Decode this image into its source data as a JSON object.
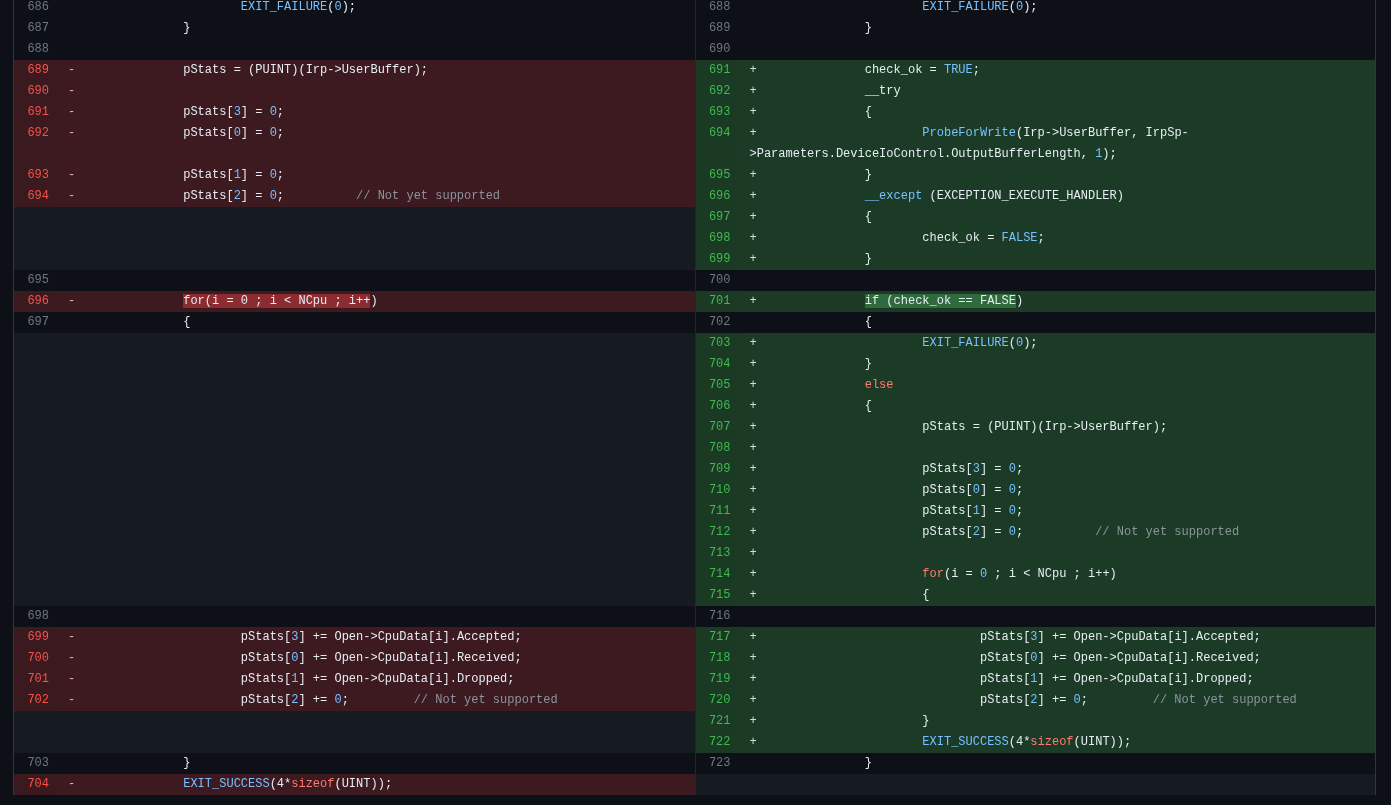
{
  "diff": {
    "rows": [
      {
        "left": {
          "kind": "context",
          "number": "686",
          "code": [
            {
              "text": "\t\t\tEXIT_FAILURE",
              "kind": "fn"
            },
            {
              "text": "(",
              "kind": "plain"
            },
            {
              "text": "0",
              "kind": "num"
            },
            {
              "text": ");",
              "kind": "plain"
            }
          ]
        },
        "right": {
          "kind": "context",
          "number": "688",
          "code": [
            {
              "text": "\t\t\tEXIT_FAILURE",
              "kind": "fn"
            },
            {
              "text": "(",
              "kind": "plain"
            },
            {
              "text": "0",
              "kind": "num"
            },
            {
              "text": ");",
              "kind": "plain"
            }
          ]
        }
      },
      {
        "left": {
          "kind": "context",
          "number": "687",
          "code": [
            {
              "text": "\t\t}",
              "kind": "plain"
            }
          ]
        },
        "right": {
          "kind": "context",
          "number": "689",
          "code": [
            {
              "text": "\t\t}",
              "kind": "plain"
            }
          ]
        }
      },
      {
        "left": {
          "kind": "context",
          "number": "688"
        },
        "right": {
          "kind": "context",
          "number": "690"
        }
      },
      {
        "left": {
          "kind": "deleted",
          "number": "689",
          "marker": "-",
          "code": [
            {
              "text": "\t\tpStats = (PUINT)(Irp->UserBuffer);",
              "kind": "plain"
            }
          ]
        },
        "right": {
          "kind": "added",
          "number": "691",
          "marker": "+",
          "code": [
            {
              "text": "\t\tcheck_ok = ",
              "kind": "plain"
            },
            {
              "text": "TRUE",
              "kind": "const"
            },
            {
              "text": ";",
              "kind": "plain"
            }
          ]
        }
      },
      {
        "left": {
          "kind": "deleted",
          "number": "690",
          "marker": "-"
        },
        "right": {
          "kind": "added",
          "number": "692",
          "marker": "+",
          "code": [
            {
              "text": "\t\t__try",
              "kind": "plain"
            }
          ]
        }
      },
      {
        "left": {
          "kind": "deleted",
          "number": "691",
          "marker": "-",
          "code": [
            {
              "text": "\t\tpStats[",
              "kind": "plain"
            },
            {
              "text": "3",
              "kind": "num"
            },
            {
              "text": "] = ",
              "kind": "plain"
            },
            {
              "text": "0",
              "kind": "num"
            },
            {
              "text": ";",
              "kind": "plain"
            }
          ]
        },
        "right": {
          "kind": "added",
          "number": "693",
          "marker": "+",
          "code": [
            {
              "text": "\t\t{",
              "kind": "plain"
            }
          ]
        }
      },
      {
        "left": {
          "kind": "deleted",
          "number": "692",
          "marker": "-",
          "code": [
            {
              "text": "\t\tpStats[",
              "kind": "plain"
            },
            {
              "text": "0",
              "kind": "num"
            },
            {
              "text": "] = ",
              "kind": "plain"
            },
            {
              "text": "0",
              "kind": "num"
            },
            {
              "text": ";",
              "kind": "plain"
            }
          ]
        },
        "right": {
          "kind": "added",
          "number": "694",
          "marker": "+",
          "code": [
            {
              "text": "\t\t\tProbeForWrite",
              "kind": "fn"
            },
            {
              "text": "(Irp->UserBuffer, IrpSp->Parameters.DeviceIoControl.OutputBufferLength, ",
              "kind": "plain"
            },
            {
              "text": "1",
              "kind": "num"
            },
            {
              "text": ");",
              "kind": "plain"
            }
          ]
        }
      },
      {
        "left": {
          "kind": "deleted",
          "number": "693",
          "marker": "-",
          "code": [
            {
              "text": "\t\tpStats[",
              "kind": "plain"
            },
            {
              "text": "1",
              "kind": "num"
            },
            {
              "text": "] = ",
              "kind": "plain"
            },
            {
              "text": "0",
              "kind": "num"
            },
            {
              "text": ";",
              "kind": "plain"
            }
          ]
        },
        "right": {
          "kind": "added",
          "number": "695",
          "marker": "+",
          "code": [
            {
              "text": "\t\t}",
              "kind": "plain"
            }
          ]
        }
      },
      {
        "left": {
          "kind": "deleted",
          "number": "694",
          "marker": "-",
          "code": [
            {
              "text": "\t\tpStats[",
              "kind": "plain"
            },
            {
              "text": "2",
              "kind": "num"
            },
            {
              "text": "] = ",
              "kind": "plain"
            },
            {
              "text": "0",
              "kind": "num"
            },
            {
              "text": ";\t\t",
              "kind": "plain"
            },
            {
              "text": "// Not yet supported",
              "kind": "comment"
            }
          ]
        },
        "right": {
          "kind": "added",
          "number": "696",
          "marker": "+",
          "code": [
            {
              "text": "\t\t__except",
              "kind": "fn"
            },
            {
              "text": " (EXCEPTION_EXECUTE_HANDLER)",
              "kind": "plain"
            }
          ]
        }
      },
      {
        "left": {
          "kind": "empty"
        },
        "right": {
          "kind": "added",
          "number": "697",
          "marker": "+",
          "code": [
            {
              "text": "\t\t{",
              "kind": "plain"
            }
          ]
        }
      },
      {
        "left": {
          "kind": "empty"
        },
        "right": {
          "kind": "added",
          "number": "698",
          "marker": "+",
          "code": [
            {
              "text": "\t\t\tcheck_ok = ",
              "kind": "plain"
            },
            {
              "text": "FALSE",
              "kind": "const"
            },
            {
              "text": ";",
              "kind": "plain"
            }
          ]
        }
      },
      {
        "left": {
          "kind": "empty"
        },
        "right": {
          "kind": "added",
          "number": "699",
          "marker": "+",
          "code": [
            {
              "text": "\t\t}",
              "kind": "plain"
            }
          ]
        }
      },
      {
        "left": {
          "kind": "context",
          "number": "695"
        },
        "right": {
          "kind": "context",
          "number": "700"
        }
      },
      {
        "left": {
          "kind": "deleted",
          "number": "696",
          "marker": "-",
          "code": [
            {
              "text": "\t\tfor(i = 0 ; i < NCpu ; i++",
              "kind": "plain",
              "highlight": true
            },
            {
              "text": ")",
              "kind": "plain"
            }
          ]
        },
        "right": {
          "kind": "added",
          "number": "701",
          "marker": "+",
          "code": [
            {
              "text": "\t\tif (check_ok == FALSE",
              "kind": "plain",
              "highlight": true
            },
            {
              "text": ")",
              "kind": "plain"
            }
          ]
        }
      },
      {
        "left": {
          "kind": "context",
          "number": "697",
          "code": [
            {
              "text": "\t\t{",
              "kind": "plain"
            }
          ]
        },
        "right": {
          "kind": "context",
          "number": "702",
          "code": [
            {
              "text": "\t\t{",
              "kind": "plain"
            }
          ]
        }
      },
      {
        "left": {
          "kind": "empty"
        },
        "right": {
          "kind": "added",
          "number": "703",
          "marker": "+",
          "code": [
            {
              "text": "\t\t\tEXIT_FAILURE",
              "kind": "fn"
            },
            {
              "text": "(",
              "kind": "plain"
            },
            {
              "text": "0",
              "kind": "num"
            },
            {
              "text": ");",
              "kind": "plain"
            }
          ]
        }
      },
      {
        "left": {
          "kind": "empty"
        },
        "right": {
          "kind": "added",
          "number": "704",
          "marker": "+",
          "code": [
            {
              "text": "\t\t}",
              "kind": "plain"
            }
          ]
        }
      },
      {
        "left": {
          "kind": "empty"
        },
        "right": {
          "kind": "added",
          "number": "705",
          "marker": "+",
          "code": [
            {
              "text": "\t\telse",
              "kind": "kw"
            }
          ]
        }
      },
      {
        "left": {
          "kind": "empty"
        },
        "right": {
          "kind": "added",
          "number": "706",
          "marker": "+",
          "code": [
            {
              "text": "\t\t{",
              "kind": "plain"
            }
          ]
        }
      },
      {
        "left": {
          "kind": "empty"
        },
        "right": {
          "kind": "added",
          "number": "707",
          "marker": "+",
          "code": [
            {
              "text": "\t\t\tpStats = (PUINT)(Irp->UserBuffer);",
              "kind": "plain"
            }
          ]
        }
      },
      {
        "left": {
          "kind": "empty"
        },
        "right": {
          "kind": "added",
          "number": "708",
          "marker": "+"
        }
      },
      {
        "left": {
          "kind": "empty"
        },
        "right": {
          "kind": "added",
          "number": "709",
          "marker": "+",
          "code": [
            {
              "text": "\t\t\tpStats[",
              "kind": "plain"
            },
            {
              "text": "3",
              "kind": "num"
            },
            {
              "text": "] = ",
              "kind": "plain"
            },
            {
              "text": "0",
              "kind": "num"
            },
            {
              "text": ";",
              "kind": "plain"
            }
          ]
        }
      },
      {
        "left": {
          "kind": "empty"
        },
        "right": {
          "kind": "added",
          "number": "710",
          "marker": "+",
          "code": [
            {
              "text": "\t\t\tpStats[",
              "kind": "plain"
            },
            {
              "text": "0",
              "kind": "num"
            },
            {
              "text": "] = ",
              "kind": "plain"
            },
            {
              "text": "0",
              "kind": "num"
            },
            {
              "text": ";",
              "kind": "plain"
            }
          ]
        }
      },
      {
        "left": {
          "kind": "empty"
        },
        "right": {
          "kind": "added",
          "number": "711",
          "marker": "+",
          "code": [
            {
              "text": "\t\t\tpStats[",
              "kind": "plain"
            },
            {
              "text": "1",
              "kind": "num"
            },
            {
              "text": "] = ",
              "kind": "plain"
            },
            {
              "text": "0",
              "kind": "num"
            },
            {
              "text": ";",
              "kind": "plain"
            }
          ]
        }
      },
      {
        "left": {
          "kind": "empty"
        },
        "right": {
          "kind": "added",
          "number": "712",
          "marker": "+",
          "code": [
            {
              "text": "\t\t\tpStats[",
              "kind": "plain"
            },
            {
              "text": "2",
              "kind": "num"
            },
            {
              "text": "] = ",
              "kind": "plain"
            },
            {
              "text": "0",
              "kind": "num"
            },
            {
              "text": ";\t\t",
              "kind": "plain"
            },
            {
              "text": "// Not yet supported",
              "kind": "comment"
            }
          ]
        }
      },
      {
        "left": {
          "kind": "empty"
        },
        "right": {
          "kind": "added",
          "number": "713",
          "marker": "+"
        }
      },
      {
        "left": {
          "kind": "empty"
        },
        "right": {
          "kind": "added",
          "number": "714",
          "marker": "+",
          "code": [
            {
              "text": "\t\t\tfor",
              "kind": "kw"
            },
            {
              "text": "(i = ",
              "kind": "plain"
            },
            {
              "text": "0",
              "kind": "num"
            },
            {
              "text": " ; i < NCpu ; i++)",
              "kind": "plain"
            }
          ]
        }
      },
      {
        "left": {
          "kind": "empty"
        },
        "right": {
          "kind": "added",
          "number": "715",
          "marker": "+",
          "code": [
            {
              "text": "\t\t\t{",
              "kind": "plain"
            }
          ]
        }
      },
      {
        "left": {
          "kind": "context",
          "number": "698"
        },
        "right": {
          "kind": "context",
          "number": "716"
        }
      },
      {
        "left": {
          "kind": "deleted",
          "number": "699",
          "marker": "-",
          "code": [
            {
              "text": "\t\t\tpStats[",
              "kind": "plain"
            },
            {
              "text": "3",
              "kind": "num"
            },
            {
              "text": "] += Open->CpuData[i].Accepted;",
              "kind": "plain"
            }
          ]
        },
        "right": {
          "kind": "added",
          "number": "717",
          "marker": "+",
          "code": [
            {
              "text": "\t\t\t\tpStats[",
              "kind": "plain"
            },
            {
              "text": "3",
              "kind": "num"
            },
            {
              "text": "] += Open->CpuData[i].Accepted;",
              "kind": "plain"
            }
          ]
        }
      },
      {
        "left": {
          "kind": "deleted",
          "number": "700",
          "marker": "-",
          "code": [
            {
              "text": "\t\t\tpStats[",
              "kind": "plain"
            },
            {
              "text": "0",
              "kind": "num"
            },
            {
              "text": "] += Open->CpuData[i].Received;",
              "kind": "plain"
            }
          ]
        },
        "right": {
          "kind": "added",
          "number": "718",
          "marker": "+",
          "code": [
            {
              "text": "\t\t\t\tpStats[",
              "kind": "plain"
            },
            {
              "text": "0",
              "kind": "num"
            },
            {
              "text": "] += Open->CpuData[i].Received;",
              "kind": "plain"
            }
          ]
        }
      },
      {
        "left": {
          "kind": "deleted",
          "number": "701",
          "marker": "-",
          "code": [
            {
              "text": "\t\t\tpStats[",
              "kind": "plain"
            },
            {
              "text": "1",
              "kind": "num"
            },
            {
              "text": "] += Open->CpuData[i].Dropped;",
              "kind": "plain"
            }
          ]
        },
        "right": {
          "kind": "added",
          "number": "719",
          "marker": "+",
          "code": [
            {
              "text": "\t\t\t\tpStats[",
              "kind": "plain"
            },
            {
              "text": "1",
              "kind": "num"
            },
            {
              "text": "] += Open->CpuData[i].Dropped;",
              "kind": "plain"
            }
          ]
        }
      },
      {
        "left": {
          "kind": "deleted",
          "number": "702",
          "marker": "-",
          "code": [
            {
              "text": "\t\t\tpStats[",
              "kind": "plain"
            },
            {
              "text": "2",
              "kind": "num"
            },
            {
              "text": "] += ",
              "kind": "plain"
            },
            {
              "text": "0",
              "kind": "num"
            },
            {
              "text": ";\t\t",
              "kind": "plain"
            },
            {
              "text": "// Not yet supported",
              "kind": "comment"
            }
          ]
        },
        "right": {
          "kind": "added",
          "number": "720",
          "marker": "+",
          "code": [
            {
              "text": "\t\t\t\tpStats[",
              "kind": "plain"
            },
            {
              "text": "2",
              "kind": "num"
            },
            {
              "text": "] += ",
              "kind": "plain"
            },
            {
              "text": "0",
              "kind": "num"
            },
            {
              "text": ";\t\t",
              "kind": "plain"
            },
            {
              "text": "// Not yet supported",
              "kind": "comment"
            }
          ]
        }
      },
      {
        "left": {
          "kind": "empty"
        },
        "right": {
          "kind": "added",
          "number": "721",
          "marker": "+",
          "code": [
            {
              "text": "\t\t\t}",
              "kind": "plain"
            }
          ]
        }
      },
      {
        "left": {
          "kind": "empty"
        },
        "right": {
          "kind": "added",
          "number": "722",
          "marker": "+",
          "code": [
            {
              "text": "\t\t\tEXIT_SUCCESS",
              "kind": "fn"
            },
            {
              "text": "(4*",
              "kind": "plain"
            },
            {
              "text": "sizeof",
              "kind": "kw"
            },
            {
              "text": "(UINT));",
              "kind": "plain"
            }
          ]
        }
      },
      {
        "left": {
          "kind": "context",
          "number": "703",
          "code": [
            {
              "text": "\t\t}",
              "kind": "plain"
            }
          ]
        },
        "right": {
          "kind": "context",
          "number": "723",
          "code": [
            {
              "text": "\t\t}",
              "kind": "plain"
            }
          ]
        }
      },
      {
        "left": {
          "kind": "deleted",
          "number": "704",
          "marker": "-",
          "code": [
            {
              "text": "\t\tEXIT_SUCCESS",
              "kind": "fn"
            },
            {
              "text": "(4*",
              "kind": "plain"
            },
            {
              "text": "sizeof",
              "kind": "kw"
            },
            {
              "text": "(UINT));",
              "kind": "plain"
            }
          ]
        },
        "right": {
          "kind": "empty"
        }
      }
    ]
  }
}
